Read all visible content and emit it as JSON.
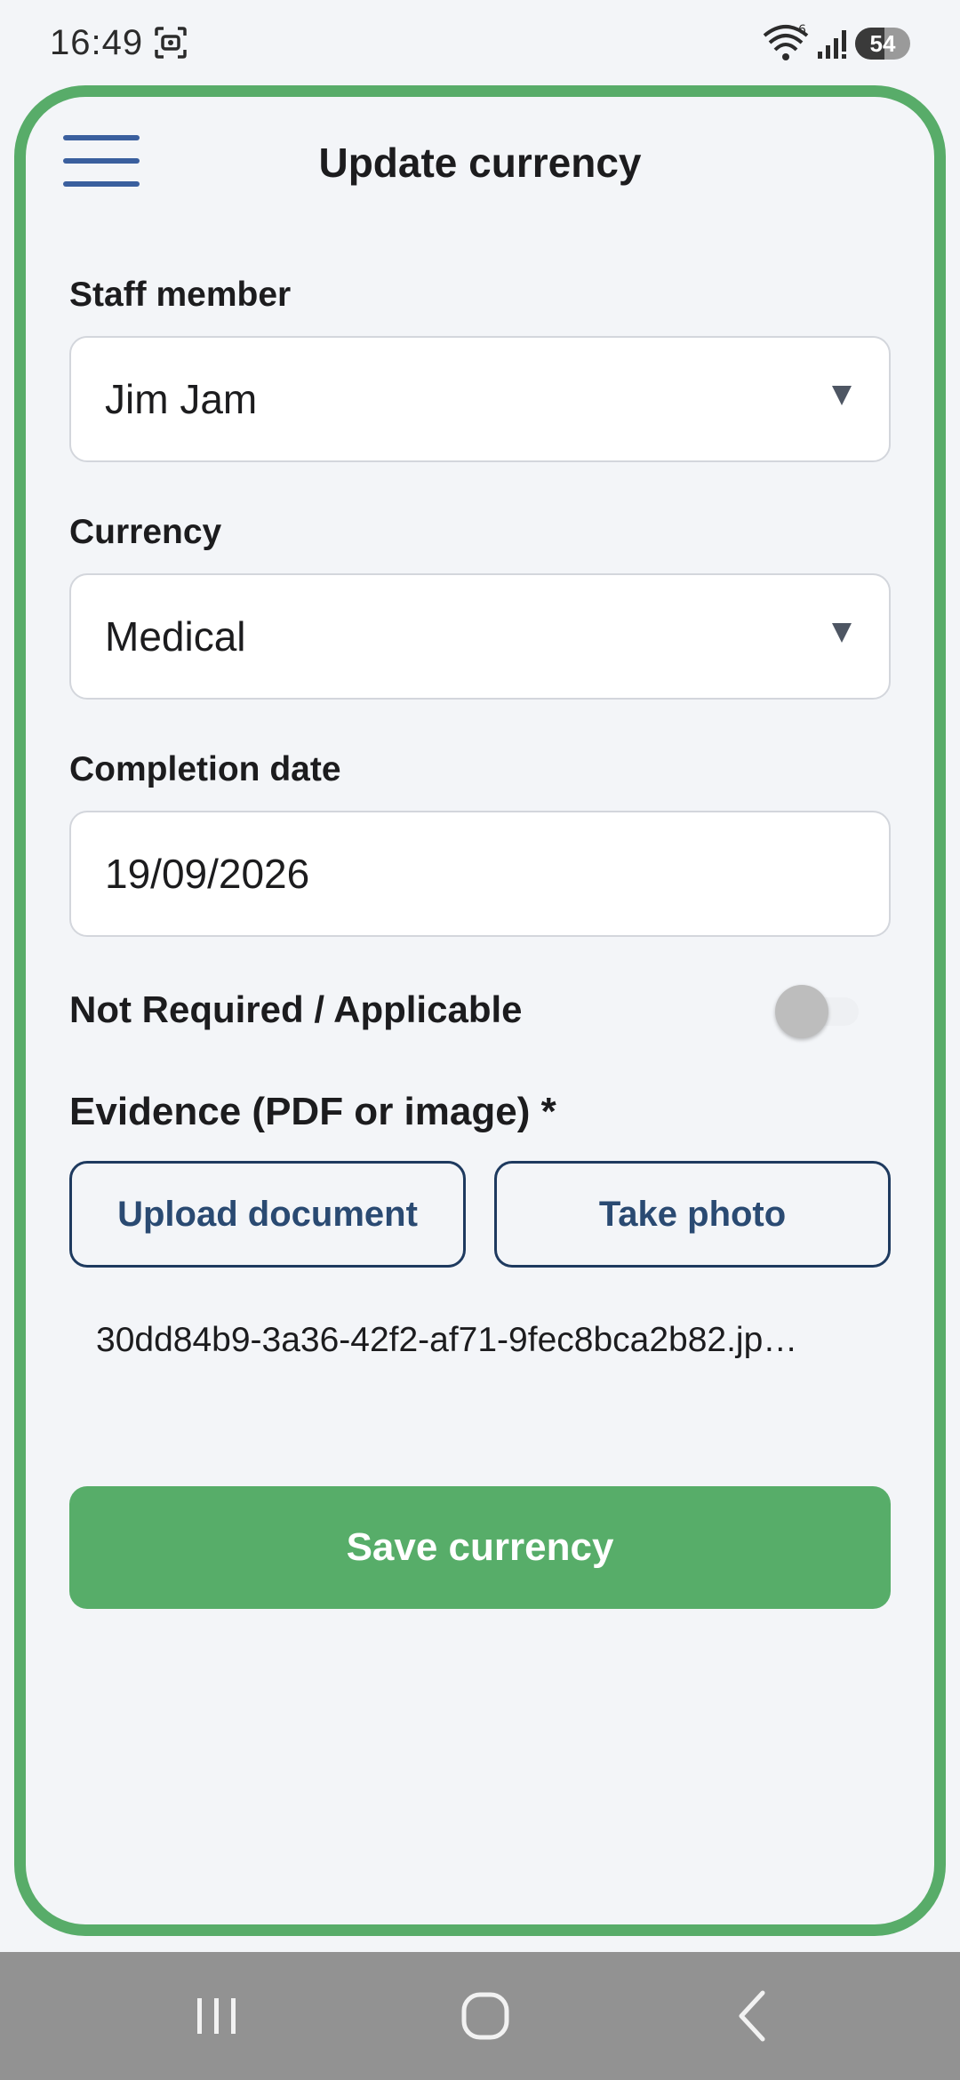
{
  "status_bar": {
    "time": "16:49",
    "battery_level": "54",
    "icons": [
      "screenshot-icon",
      "wifi-icon",
      "signal-icon",
      "battery-icon"
    ],
    "wifi_badge": "6"
  },
  "header": {
    "menu_icon": "hamburger-menu-icon",
    "title": "Update currency"
  },
  "form": {
    "staff_member": {
      "label": "Staff member",
      "value": "Jim Jam"
    },
    "currency": {
      "label": "Currency",
      "value": "Medical"
    },
    "completion_date": {
      "label": "Completion date",
      "value": "19/09/2026"
    },
    "not_required": {
      "label": "Not Required / Applicable",
      "checked": false
    },
    "evidence": {
      "label": "Evidence (PDF or image) *",
      "upload_label": "Upload document",
      "photo_label": "Take photo",
      "file_name": "30dd84b9-3a36-42f2-af71-9fec8bca2b82.jp…"
    },
    "save_label": "Save currency"
  },
  "nav_bar": {
    "icons": [
      "recent-apps-icon",
      "home-icon",
      "back-icon"
    ]
  },
  "colors": {
    "accent_green": "#57ad69",
    "frame_green": "#58ac69",
    "navy": "#1e3a5f",
    "menu_blue": "#3a5f9e",
    "background": "#f3f5f8",
    "nav_gray": "#929292"
  }
}
